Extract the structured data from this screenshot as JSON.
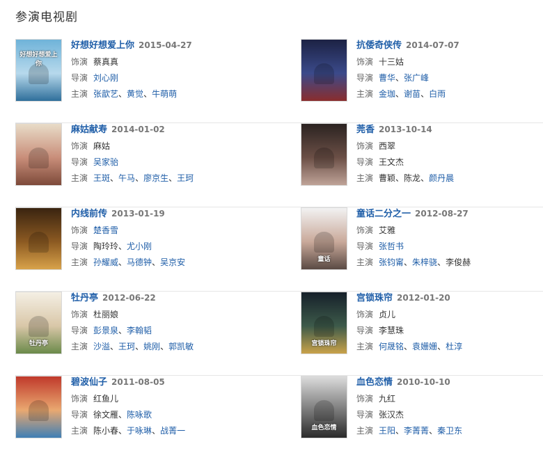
{
  "section_title": "参演电视剧",
  "labels": {
    "role": "饰演",
    "director": "导演",
    "cast": "主演"
  },
  "rows": [
    [
      {
        "title": "好想好想爱上你",
        "date": "2015-04-27",
        "poster_text": "好想好想爱上你",
        "role": [
          {
            "t": "蔡真真",
            "link": false
          }
        ],
        "director": [
          {
            "t": "刘心刚",
            "link": true
          }
        ],
        "cast": [
          {
            "t": "张歆艺",
            "link": true
          },
          {
            "t": "黄觉",
            "link": true
          },
          {
            "t": "牛萌萌",
            "link": true
          }
        ],
        "colors": [
          "#6fb3d9",
          "#b7d9ec",
          "#2f6f9b"
        ]
      },
      {
        "title": "抗倭奇侠传",
        "date": "2014-07-07",
        "poster_text": "",
        "role": [
          {
            "t": "十三姑",
            "link": false
          }
        ],
        "director": [
          {
            "t": "曹华",
            "link": true
          },
          {
            "t": "张广峰",
            "link": true
          }
        ],
        "cast": [
          {
            "t": "金珈",
            "link": true
          },
          {
            "t": "谢苗",
            "link": true
          },
          {
            "t": "白雨",
            "link": true
          }
        ],
        "colors": [
          "#1c2244",
          "#3b4a8a",
          "#8a2d2d"
        ]
      }
    ],
    [
      {
        "title": "麻姑献寿",
        "date": "2014-01-02",
        "poster_text": "",
        "role": [
          {
            "t": "麻姑",
            "link": false
          }
        ],
        "director": [
          {
            "t": "吴家骀",
            "link": true
          }
        ],
        "cast": [
          {
            "t": "王斑",
            "link": true
          },
          {
            "t": "午马",
            "link": true
          },
          {
            "t": "廖京生",
            "link": true
          },
          {
            "t": "王珂",
            "link": true
          }
        ],
        "colors": [
          "#e8dcc8",
          "#c98e7a",
          "#7d4a3a"
        ]
      },
      {
        "title": "莞香",
        "date": "2013-10-14",
        "poster_text": "",
        "role": [
          {
            "t": "西翠",
            "link": false
          }
        ],
        "director": [
          {
            "t": "王文杰",
            "link": false
          }
        ],
        "cast": [
          {
            "t": "曹颖",
            "link": false
          },
          {
            "t": "陈龙",
            "link": false
          },
          {
            "t": "颜丹晨",
            "link": true
          }
        ],
        "colors": [
          "#2b2321",
          "#6b4f46",
          "#bfa398"
        ]
      }
    ],
    [
      {
        "title": "内线前传",
        "date": "2013-01-19",
        "poster_text": "",
        "role": [
          {
            "t": "楚香雪",
            "link": true
          }
        ],
        "director": [
          {
            "t": "陶玲玲",
            "link": false
          },
          {
            "t": "尤小刚",
            "link": true
          }
        ],
        "cast": [
          {
            "t": "孙耀威",
            "link": true
          },
          {
            "t": "马德钟",
            "link": true
          },
          {
            "t": "吴京安",
            "link": true
          }
        ],
        "colors": [
          "#3a2410",
          "#8c5a22",
          "#d8a24a"
        ]
      },
      {
        "title": "童话二分之一",
        "date": "2012-08-27",
        "poster_text": "童话",
        "role": [
          {
            "t": "艾雅",
            "link": false
          }
        ],
        "director": [
          {
            "t": "张哲书",
            "link": true
          }
        ],
        "cast": [
          {
            "t": "张钧甯",
            "link": true
          },
          {
            "t": "朱梓骁",
            "link": true
          },
          {
            "t": "李俊赫",
            "link": false
          }
        ],
        "colors": [
          "#f2f2f2",
          "#c9a99a",
          "#5a4a44"
        ]
      }
    ],
    [
      {
        "title": "牡丹亭",
        "date": "2012-06-22",
        "poster_text": "牡丹亭",
        "role": [
          {
            "t": "杜丽娘",
            "link": false
          }
        ],
        "director": [
          {
            "t": "彭景泉",
            "link": true
          },
          {
            "t": "李翰韬",
            "link": true
          }
        ],
        "cast": [
          {
            "t": "沙溢",
            "link": true
          },
          {
            "t": "王珂",
            "link": true
          },
          {
            "t": "姚刚",
            "link": true
          },
          {
            "t": "郭凯敏",
            "link": true
          }
        ],
        "colors": [
          "#f4efe4",
          "#d9c7a8",
          "#6b8a4a"
        ]
      },
      {
        "title": "宫锁珠帘",
        "date": "2012-01-20",
        "poster_text": "宫锁珠帘",
        "role": [
          {
            "t": "贞儿",
            "link": false
          }
        ],
        "director": [
          {
            "t": "李慧珠",
            "link": false
          }
        ],
        "cast": [
          {
            "t": "何晟铭",
            "link": true
          },
          {
            "t": "袁姗姗",
            "link": true
          },
          {
            "t": "杜淳",
            "link": true
          }
        ],
        "colors": [
          "#16202a",
          "#3d5a4a",
          "#c9a24a"
        ]
      }
    ],
    [
      {
        "title": "碧波仙子",
        "date": "2011-08-05",
        "poster_text": "",
        "role": [
          {
            "t": "红鱼儿",
            "link": false
          }
        ],
        "director": [
          {
            "t": "徐文雁",
            "link": false
          },
          {
            "t": "陈咏歌",
            "link": true
          }
        ],
        "cast": [
          {
            "t": "陈小春",
            "link": false
          },
          {
            "t": "于咏琳",
            "link": true
          },
          {
            "t": "战菁一",
            "link": true
          }
        ],
        "colors": [
          "#c0392b",
          "#e9a870",
          "#3f7fb5"
        ]
      },
      {
        "title": "血色恋情",
        "date": "2010-10-10",
        "poster_text": "血色恋情",
        "role": [
          {
            "t": "九红",
            "link": false
          }
        ],
        "director": [
          {
            "t": "张汉杰",
            "link": false
          }
        ],
        "cast": [
          {
            "t": "王阳",
            "link": true
          },
          {
            "t": "李菁菁",
            "link": true
          },
          {
            "t": "秦卫东",
            "link": true
          }
        ],
        "colors": [
          "#dcdcdc",
          "#7a7a7a",
          "#2b2b2b"
        ]
      }
    ]
  ]
}
